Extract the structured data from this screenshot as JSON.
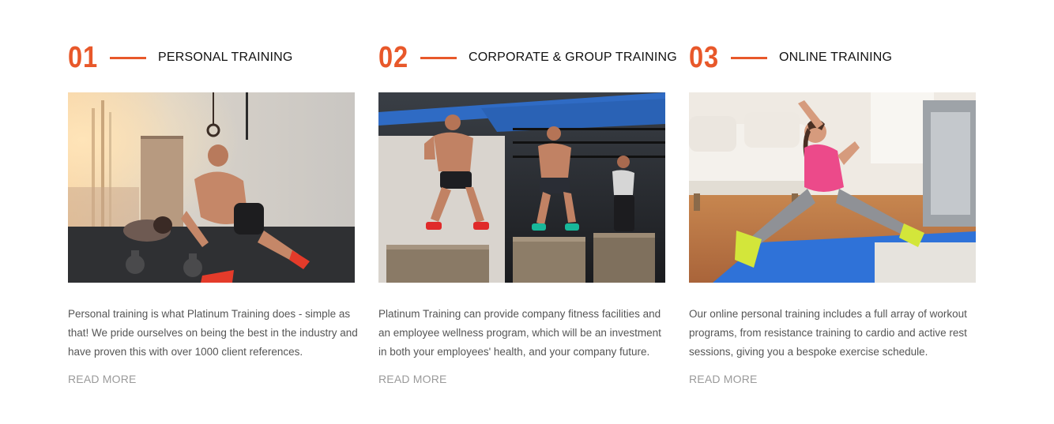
{
  "services": [
    {
      "number": "01",
      "title": "PERSONAL TRAINING",
      "description": "Personal training is what Platinum Training does - simple as that! We pride ourselves on being the best in the industry and have proven this with over 1000 client references.",
      "link_label": "READ MORE"
    },
    {
      "number": "02",
      "title": "CORPORATE & GROUP TRAINING",
      "description": "Platinum Training can provide company fitness facilities and an employee wellness program, which will be an investment in both your employees' health, and your company future.",
      "link_label": "READ MORE"
    },
    {
      "number": "03",
      "title": "ONLINE TRAINING",
      "description": "Our online personal training includes a full array of workout programs, from resistance training to cardio and active rest sessions, giving you a bespoke exercise schedule.",
      "link_label": "READ MORE"
    }
  ],
  "colors": {
    "accent": "#e8582a",
    "heading": "#111111",
    "body_text": "#555555",
    "link": "#9a9a9a"
  }
}
